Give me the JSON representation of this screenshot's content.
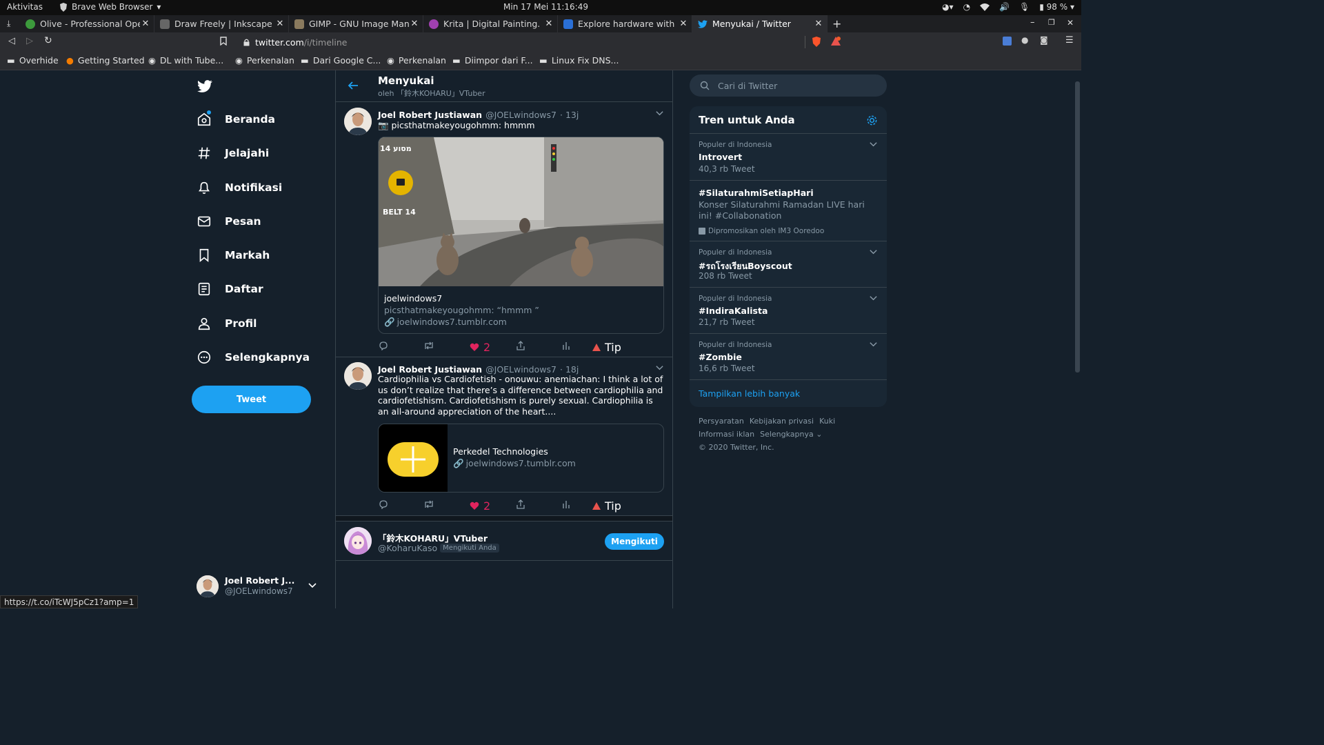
{
  "topbar": {
    "activities": "Aktivitas",
    "app_name": "Brave Web Browser",
    "clock": "Min 17 Mei  11:16:49",
    "battery": "98 %"
  },
  "tabs": [
    {
      "title": "Olive - Professional Open-S",
      "color": "#3c9a3c"
    },
    {
      "title": "Draw Freely | Inkscape",
      "color": "#555555"
    },
    {
      "title": "GIMP - GNU Image Manipul",
      "color": "#8a7a5e"
    },
    {
      "title": "Krita | Digital Painting. Cre",
      "color": "#a040b0"
    },
    {
      "title": "Explore hardware with Pla",
      "color": "#2a6fd6"
    },
    {
      "title": "Menyukai / Twitter",
      "color": "#1da1f2"
    }
  ],
  "address": {
    "domain": "twitter.com",
    "path": "/i/timeline"
  },
  "bookmarks": [
    "Overhide",
    "Getting Started",
    "DL with Tube...",
    "Perkenalan",
    "Dari Google C...",
    "Perkenalan",
    "Diimpor dari F...",
    "Linux Fix DNS..."
  ],
  "nav": {
    "items": [
      "Beranda",
      "Jelajahi",
      "Notifikasi",
      "Pesan",
      "Markah",
      "Daftar",
      "Profil",
      "Selengkapnya"
    ],
    "tweet_button": "Tweet",
    "account_name": "Joel Robert J...",
    "account_handle": "@JOELwindows7"
  },
  "header": {
    "title": "Menyukai",
    "subtitle": "oleh 「鈴木KOHARU」VTuber"
  },
  "tweets": [
    {
      "name": "Joel Robert Justiawan",
      "handle": "@JOELwindows7",
      "time": "· 13j",
      "text": "📷 picsthatmakeyougohmm: hmmm",
      "card_title": "joelwindows7",
      "card_desc": "picsthatmakeyougohmm: “hmmm ”",
      "card_link": "joelwindows7.tumblr.com",
      "photo_sign": "14 מסוע",
      "photo_belt": "BELT 14",
      "likes": "2",
      "tip": "Tip"
    },
    {
      "name": "Joel Robert Justiawan",
      "handle": "@JOELwindows7",
      "time": "· 18j",
      "text": "Cardiophilia vs Cardiofetish - onouwu: anemiachan: I think a lot of us don’t realize that there’s a difference between cardiophilia and cardiofetishism. Cardiofetishism is purely sexual. Cardiophilia is an all-around appreciation of the heart....",
      "card_title": "Perkedel Technologies",
      "card_link": "joelwindows7.tumblr.com",
      "likes": "2",
      "tip": "Tip"
    }
  ],
  "follow": {
    "name": "「鈴木KOHARU」VTuber",
    "handle": "@KoharuKaso",
    "badge": "Mengikuti Anda",
    "button": "Mengikuti"
  },
  "search": {
    "placeholder": "Cari di Twitter"
  },
  "trends": {
    "title": "Tren untuk Anda",
    "items": [
      {
        "category": "Populer di Indonesia",
        "name": "Introvert",
        "count": "40,3 rb Tweet"
      },
      {
        "category": "",
        "name": "#SilaturahmiSetiapHari",
        "desc": "Konser Silaturahmi Ramadan LIVE hari ini! #Collabonation",
        "promo": "Dipromosikan oleh IM3 Ooredoo"
      },
      {
        "category": "Populer di Indonesia",
        "name": "#รถโรงเรียนBoyscout",
        "count": "208 rb Tweet"
      },
      {
        "category": "Populer di Indonesia",
        "name": "#IndiraKalista",
        "count": "21,7 rb Tweet"
      },
      {
        "category": "Populer di Indonesia",
        "name": "#Zombie",
        "count": "16,6 rb Tweet"
      }
    ],
    "show_more": "Tampilkan lebih banyak"
  },
  "footer": {
    "links1": [
      "Persyaratan",
      "Kebijakan privasi",
      "Kuki"
    ],
    "links2": [
      "Informasi iklan",
      "Selengkapnya"
    ],
    "copyright": "© 2020 Twitter, Inc."
  },
  "status_url": "https://t.co/iTcWJ5pCz1?amp=1",
  "colors": {
    "bg": "#15202b",
    "accent": "#1da1f2",
    "like": "#e0245e",
    "muted": "#8899a6"
  }
}
